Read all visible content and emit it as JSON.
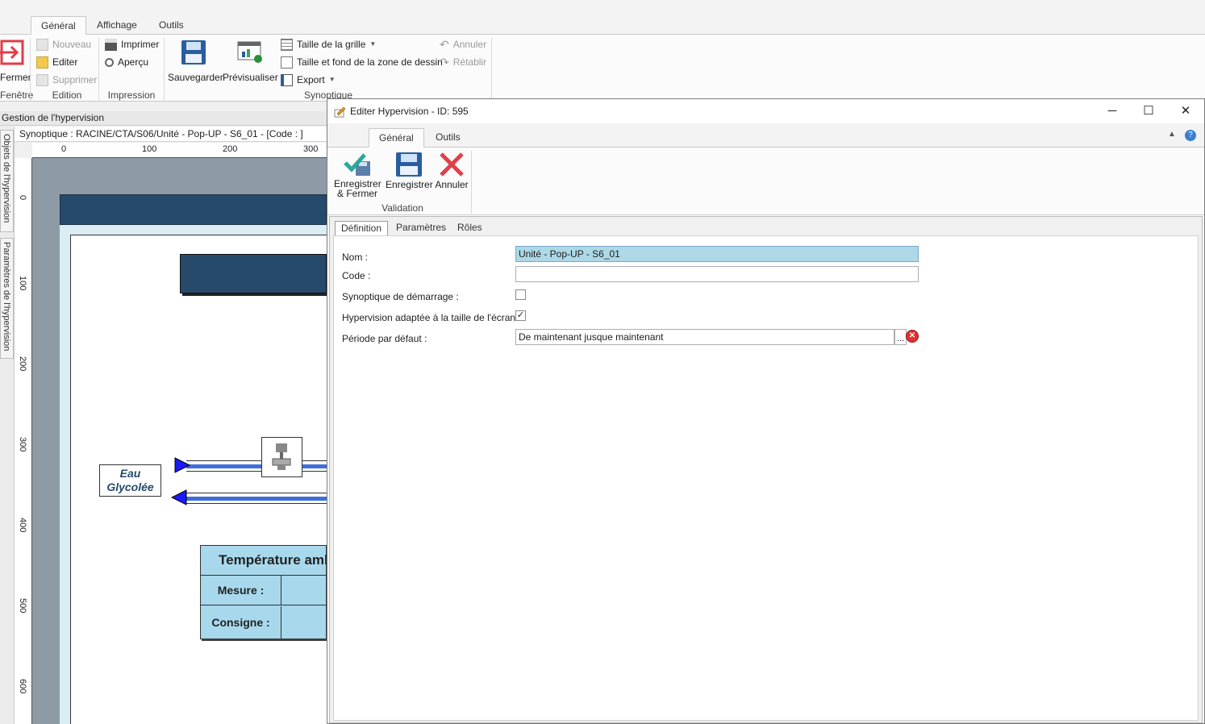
{
  "ribbon": {
    "tabs": [
      "Général",
      "Affichage",
      "Outils"
    ],
    "close_label": "Fermer",
    "window_group": "Fenêtre",
    "edition": {
      "new": "Nouveau",
      "edit": "Editer",
      "delete": "Supprimer",
      "group": "Edition"
    },
    "print": {
      "print": "Imprimer",
      "preview": "Aperçu",
      "group": "Impression"
    },
    "save": "Sauvegarder",
    "previsualize": "Prévisualiser",
    "synoptic": {
      "grid_size": "Taille de la grille",
      "bg": "Taille et fond de la zone de dessin",
      "export": "Export",
      "group": "Synoptique"
    },
    "undo": "Annuler",
    "redo": "Rétablir"
  },
  "designer": {
    "header": "Gestion de l'hypervision",
    "vtabs": [
      "Objets de l'hypervision",
      "Paramètres de l'hypervision"
    ],
    "path": "Synoptique : RACINE/CTA/S06/Unité - Pop-UP - S6_01 - [Code : ]",
    "ruler_h": [
      "0",
      "100",
      "200",
      "300"
    ],
    "ruler_v": [
      "0",
      "100",
      "200",
      "300",
      "400",
      "500",
      "600"
    ],
    "eau_line1": "Eau",
    "eau_line2": "Glycolée",
    "temp_title": "Température amb",
    "mesure": "Mesure :",
    "consigne": "Consigne :"
  },
  "dialog": {
    "title": "Editer Hypervision - ID: 595",
    "tabs": [
      "Général",
      "Outils"
    ],
    "save_close_line1": "Enregistrer",
    "save_close_line2": "& Fermer",
    "save": "Enregistrer",
    "cancel": "Annuler",
    "validation_group": "Validation",
    "subtabs": [
      "Définition",
      "Paramètres",
      "Rôles"
    ],
    "form": {
      "nom_label": "Nom :",
      "nom_value": "Unité - Pop-UP - S6_01",
      "code_label": "Code :",
      "code_value": "",
      "startup_label": "Synoptique de démarrage :",
      "startup_checked": false,
      "fit_label": "Hypervision adaptée à la taille de l'écran :",
      "fit_checked": true,
      "period_label": "Période par défaut :",
      "period_value": "De maintenant jusque maintenant",
      "ellipsis": "..."
    }
  },
  "colors": {
    "accent_blue": "#2a5d9e",
    "banner": "#264a6c",
    "selected_input": "#add8e6",
    "table_fill": "#a8d8ec"
  }
}
